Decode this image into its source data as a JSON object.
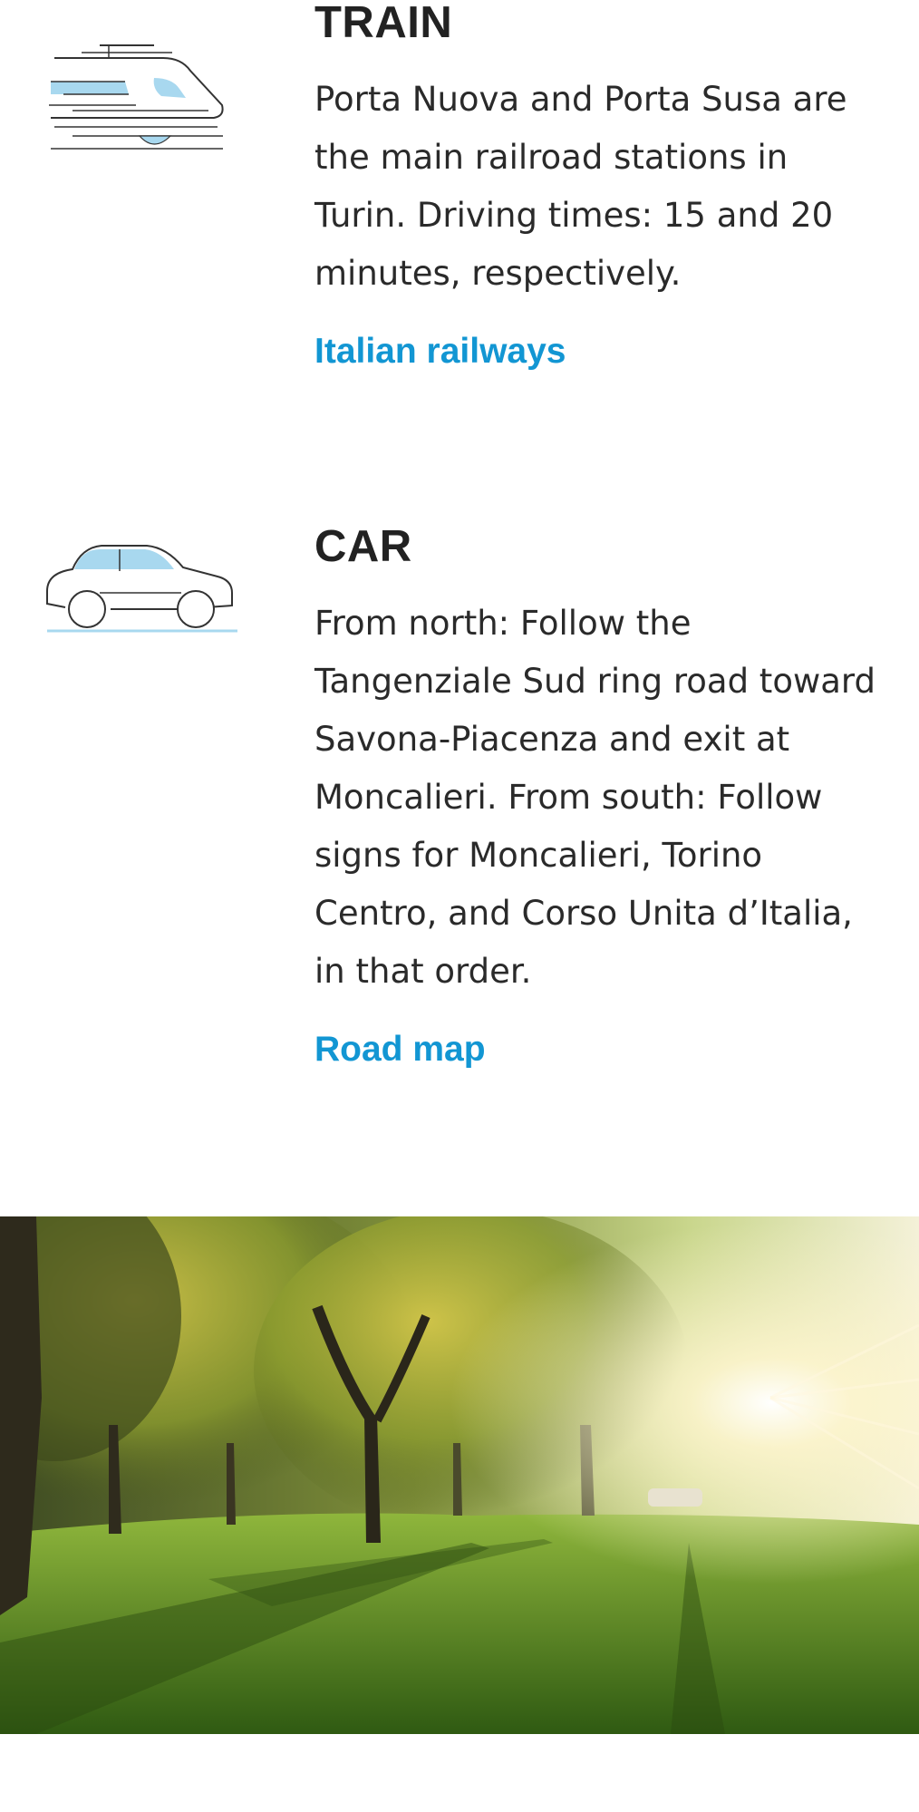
{
  "train": {
    "icon": "train-icon",
    "heading": "TRAIN",
    "body": "Porta Nuova and Porta Susa are the main railroad stations in Turin. Driving times: 15 and 20 minutes, respectively.",
    "link_label": "Italian railways"
  },
  "car": {
    "icon": "car-icon",
    "heading": "CAR",
    "body": "From north: Follow the Tangenziale Sud ring road toward Savona-Piacenza and exit at Moncalieri. From south: Follow signs for Moncalieri, Torino Centro, and Corso Unita d’Italia, in that order.",
    "link_label": "Road map"
  },
  "photo": {
    "subject": "park-with-trees-and-sunlight"
  },
  "colors": {
    "link": "#1296d3",
    "icon_fill": "#a8d8ef",
    "text": "#222222"
  }
}
